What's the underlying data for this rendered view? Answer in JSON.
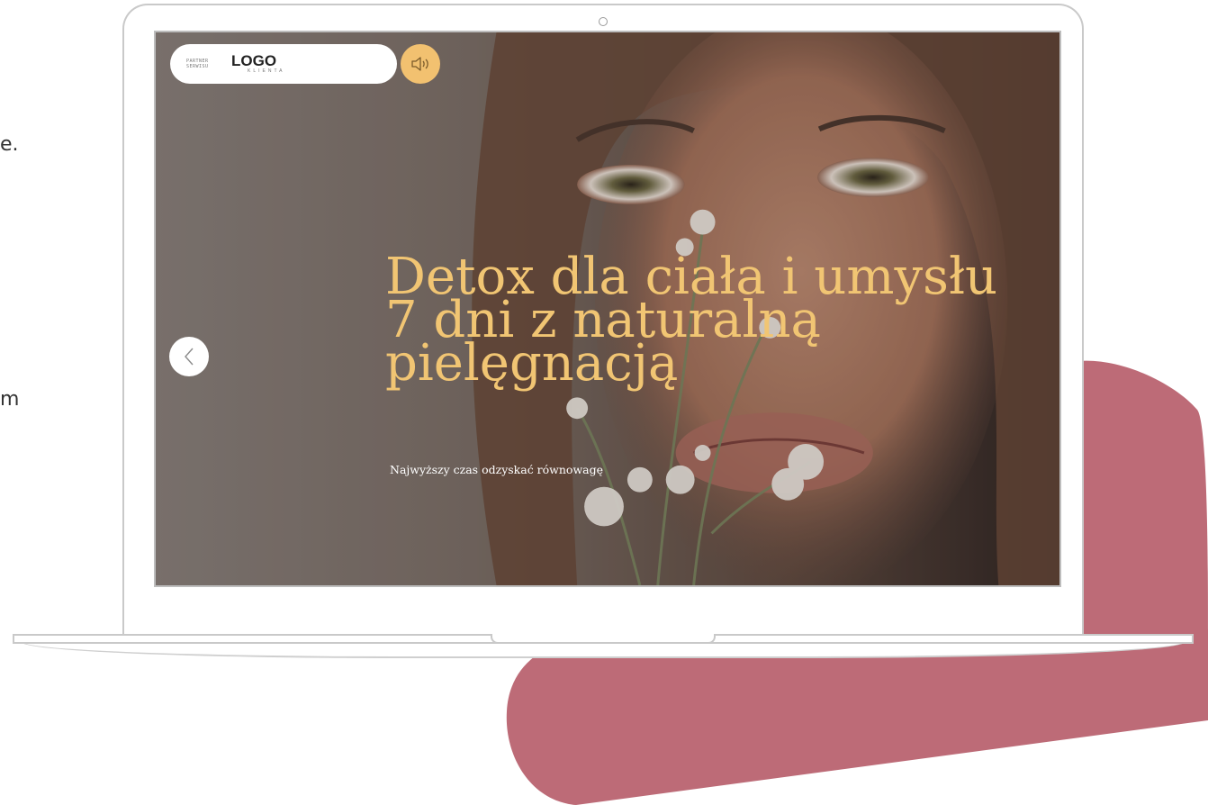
{
  "background": {
    "accent_blob_color": "#bd6b77",
    "edge_text": [
      "e.",
      "m"
    ]
  },
  "laptop": {
    "frame_color": "#c9c9c9"
  },
  "screen": {
    "header": {
      "partner_label": "PARTNER SERWISU",
      "logo_text": "LOGO",
      "logo_subtext": "KLIENTA",
      "sound_icon": "speaker-icon",
      "sound_button_color": "#f2c170"
    },
    "slider": {
      "prev_icon": "chevron-left-icon"
    },
    "hero": {
      "title_line_1": "Detox dla ciała i umysłu",
      "title_line_2": "7 dni z naturalną",
      "title_line_3": "pielęgnacją",
      "subtitle": "Najwyższy czas odzyskać równowagę",
      "title_color": "#f1c573"
    }
  }
}
